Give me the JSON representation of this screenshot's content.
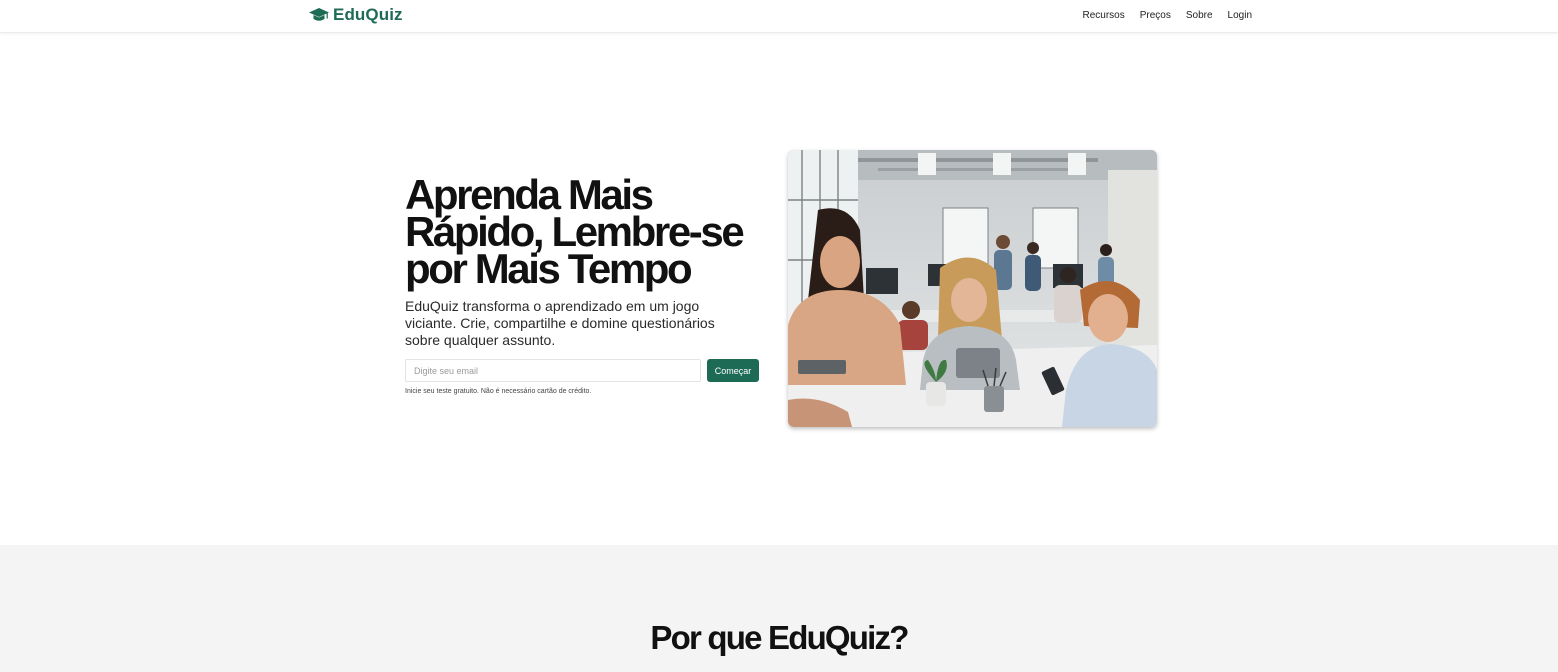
{
  "header": {
    "brand_name": "EduQuiz",
    "brand_icon": "graduation-cap-icon",
    "nav": [
      "Recursos",
      "Preços",
      "Sobre",
      "Login"
    ]
  },
  "hero": {
    "title_lines": [
      "Aprenda Mais",
      "Rápido, Lembre-se",
      "por Mais Tempo"
    ],
    "subtitle": "EduQuiz transforma o aprendizado em um jogo viciante. Crie, compartilhe e domine questionários sobre qualquer assunto.",
    "email_placeholder": "Digite seu email",
    "email_value": "",
    "cta_label": "Começar",
    "fineprint": "Inicie seu teste gratuito. Não é necessário cartão de crédito."
  },
  "features": {
    "title": "Por que EduQuiz?"
  },
  "colors": {
    "accent": "#1e6b55",
    "background": "#ffffff",
    "section_background": "#f4f4f4"
  }
}
